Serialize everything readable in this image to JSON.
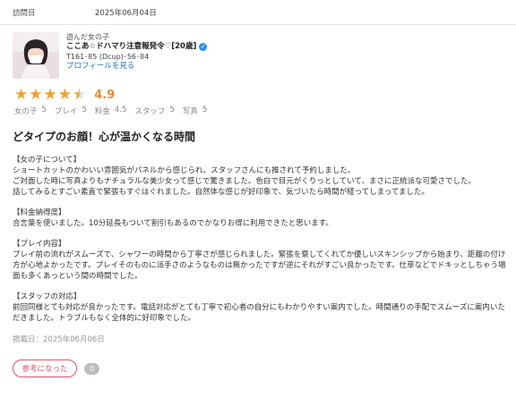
{
  "visit": {
    "label": "訪問日",
    "date": "2025年06月04日"
  },
  "girl": {
    "kind": "遊んだ女の子",
    "name": "ここあ☆ドハマり注意報発令♡[20歳]",
    "spec": "T161･85 (Dcup)･56･84",
    "profile_link": "プロフィールを見る",
    "verify_icon": "check-badge-icon"
  },
  "rating": {
    "value": "4.9",
    "stars": 4.5,
    "star_color": "#f0a030"
  },
  "sub_scores": [
    {
      "label": "女の子",
      "value": "5"
    },
    {
      "label": "プレイ",
      "value": "5"
    },
    {
      "label": "料金",
      "value": "4.5"
    },
    {
      "label": "スタッフ",
      "value": "5"
    },
    {
      "label": "写真",
      "value": "5"
    }
  ],
  "review": {
    "title": "どタイプのお顔！心が温かくなる時間",
    "sections": [
      {
        "head": "【女の子について】",
        "body": "ショートカットのかわいい雰囲気がパネルから感じられ、スタッフさんにも推されて予約しました。\nご対面した時に写真よりもナチュラルな美少女って感じで驚きました。色白で目元がくりっとしていて、まさに正統派な可愛さでした。\n話してみるとすごい素直で緊張もすぐほぐれました。自然体な感じが好印象で、気づいたら時間が経ってしまってました。"
      },
      {
        "head": "【料金納得度】",
        "body": "合言葉を使いました。10分延長もついて割引もあるのでかなりお得に利用できたと思います。"
      },
      {
        "head": "【プレイ内容】",
        "body": "プレイ前の流れがスムーズで、シャワーの時間から丁寧さが感じられました。緊張を察してくれてか優しいスキンシップから始まり、距離の付け方が心地よかったです。プレイそのものに派手さのようなものは無かったですが逆にそれがすごい良かったです。仕草などでドキッとしちゃう場面も多くあっという間の時間でした。"
      },
      {
        "head": "【スタッフの対応】",
        "body": "前回同様とても対応が良かったです。電話対応がとても丁寧で初心者の自分にもわかりやすい案内でした。時間通りの手配でスムーズに案内いただきました。トラブルもなく全体的に好印象でした。"
      }
    ]
  },
  "posted": "掲載日：2025年06月06日",
  "helpful": {
    "label": "参考になった",
    "count": "0",
    "accent": "#d9536b"
  }
}
